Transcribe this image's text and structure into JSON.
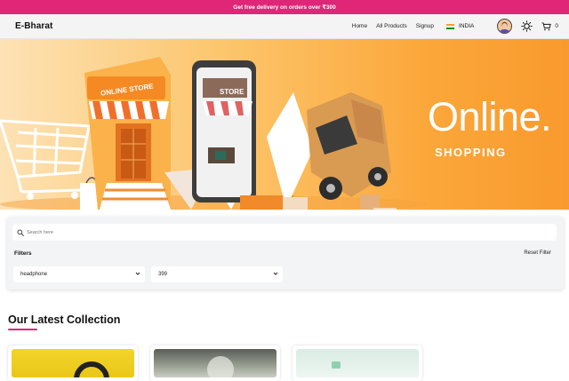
{
  "promo": {
    "text": "Get free delivery on orders over ₹300"
  },
  "nav": {
    "brand": "E-Bharat",
    "links": [
      "Home",
      "All Products",
      "Signup"
    ],
    "country": "INDIA",
    "cart_count": "0"
  },
  "hero": {
    "title": "Online.",
    "subtitle": "SHOPPING",
    "store_sign": "ONLINE STORE",
    "phone_sign": "STORE"
  },
  "search": {
    "placeholder": "Search here"
  },
  "filters": {
    "label": "Filters",
    "reset_label": "Reset Filter",
    "category_value": "headphone",
    "price_value": "399"
  },
  "collection": {
    "title": "Our Latest Collection"
  },
  "colors": {
    "accent": "#df2677",
    "hero_orange": "#fba73a"
  }
}
